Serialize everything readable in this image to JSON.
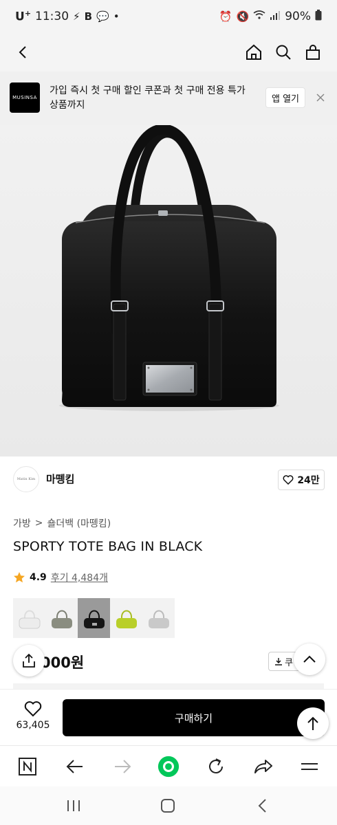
{
  "status_bar": {
    "carrier": "U",
    "carrier_sup": "+",
    "time": "11:30",
    "battery": "90%"
  },
  "banner": {
    "logo_text": "MUSINSA",
    "text": "가입 즉시 첫 구매 할인 쿠폰과 첫 구매 전용 특가 상품까지",
    "open_app_label": "앱 열기"
  },
  "brand": {
    "avatar_text": "Matin Kim",
    "name": "마뗑킴",
    "likes": "24만"
  },
  "breadcrumb": {
    "category": "가방",
    "separator": ">",
    "subcategory": "숄더백 (마뗑킴)"
  },
  "product": {
    "title": "SPORTY TOTE BAG IN BLACK",
    "rating": "4.9",
    "reviews": "후기 4,484개",
    "price": "000원",
    "coupon_label": "쿠",
    "swatches": [
      {
        "color": "#e8e8e8",
        "name": "white"
      },
      {
        "color": "#8a8d80",
        "name": "khaki"
      },
      {
        "color": "#151515",
        "name": "black"
      },
      {
        "color": "#b9cf2a",
        "name": "lime"
      },
      {
        "color": "#c9c9c9",
        "name": "grey"
      }
    ]
  },
  "buy_bar": {
    "wish_count": "63,405",
    "buy_label": "구매하기"
  },
  "colors": {
    "accent": "#000000",
    "star": "#f5a623",
    "browser_green": "#03c75a"
  }
}
